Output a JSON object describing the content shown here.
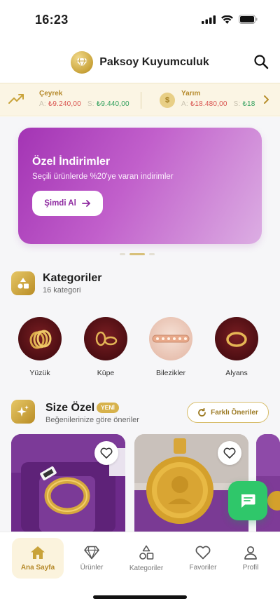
{
  "status_bar": {
    "time": "16:23"
  },
  "header": {
    "brand_name": "Paksoy Kuyumculuk"
  },
  "ticker": {
    "items": [
      {
        "name": "Çeyrek",
        "buy_label": "A:",
        "buy": "₺9.240,00",
        "sell_label": "S:",
        "sell": "₺9.440,00"
      },
      {
        "name": "Yarım",
        "buy_label": "A:",
        "buy": "₺18.480,00",
        "sell_label": "S:",
        "sell": "₺18"
      }
    ],
    "coin_symbol": "$"
  },
  "banner": {
    "title": "Özel İndirimler",
    "subtitle": "Seçili ürünlerde %20'ye varan indirimler",
    "button_label": "Şimdi Al",
    "colors": {
      "from": "#a334b4",
      "to": "#dcaee3"
    }
  },
  "categories_section": {
    "title": "Kategoriler",
    "subtitle": "16 kategori",
    "items": [
      {
        "label": "Yüzük"
      },
      {
        "label": "Küpe"
      },
      {
        "label": "Bilezikler"
      },
      {
        "label": "Alyans"
      }
    ]
  },
  "recommendations": {
    "title": "Size Özel",
    "badge": "YENİ",
    "subtitle": "Beğenilerinize göre öneriler",
    "other_button": "Farklı Öneriler"
  },
  "bottom_nav": {
    "items": [
      {
        "label": "Ana Sayfa",
        "icon": "home-icon",
        "active": true
      },
      {
        "label": "Ürünler",
        "icon": "diamond-icon"
      },
      {
        "label": "Kategoriler",
        "icon": "shapes-icon"
      },
      {
        "label": "Favoriler",
        "icon": "heart-icon"
      },
      {
        "label": "Profil",
        "icon": "user-icon"
      }
    ]
  },
  "theme": {
    "gold": "#c9a33a",
    "green": "#2fc76a",
    "buy": "#d9534f",
    "sell": "#2e9e5b"
  }
}
